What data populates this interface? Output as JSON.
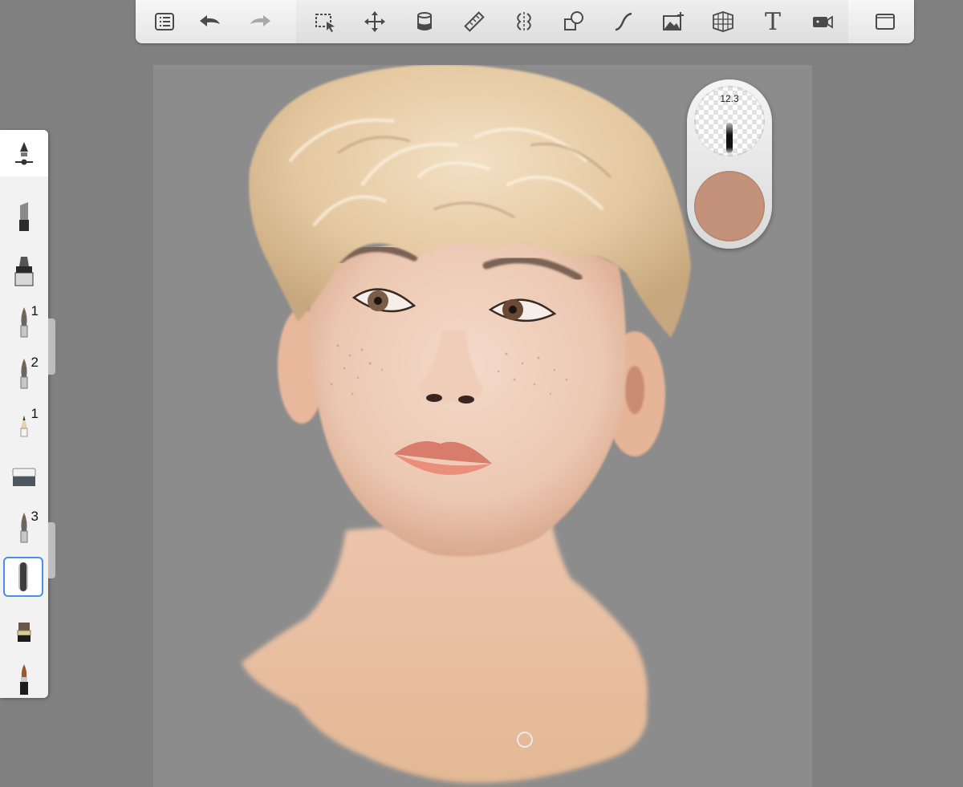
{
  "toolbar": {
    "tools": [
      "brush-library",
      "undo",
      "redo",
      "selection",
      "transform",
      "fill",
      "ruler",
      "symmetry",
      "shapes",
      "curve",
      "import-image",
      "perspective-guide",
      "text",
      "time-lapse",
      "full-screen"
    ],
    "text_tool_label": "T"
  },
  "puck": {
    "brush_size": "12.3",
    "color": "#c4917a"
  },
  "palette": {
    "items": [
      {
        "icon": "marker-icon",
        "number": ""
      },
      {
        "icon": "highlighter-icon",
        "number": ""
      },
      {
        "icon": "paint-brush-icon",
        "number": "1"
      },
      {
        "icon": "paint-brush-icon",
        "number": "2"
      },
      {
        "icon": "pencil-icon",
        "number": "1"
      },
      {
        "icon": "eraser-icon",
        "number": ""
      },
      {
        "icon": "paint-brush-icon",
        "number": "3"
      },
      {
        "icon": "airbrush-icon",
        "number": ""
      },
      {
        "icon": "flat-brush-icon",
        "number": ""
      },
      {
        "icon": "ink-pen-icon",
        "number": ""
      }
    ],
    "selected_index": 7
  },
  "colors": {
    "toolbar_bg": "#ececec",
    "canvas_bg": "#8c8c8c",
    "app_bg": "#808080",
    "selection_highlight": "#4a90e2"
  }
}
